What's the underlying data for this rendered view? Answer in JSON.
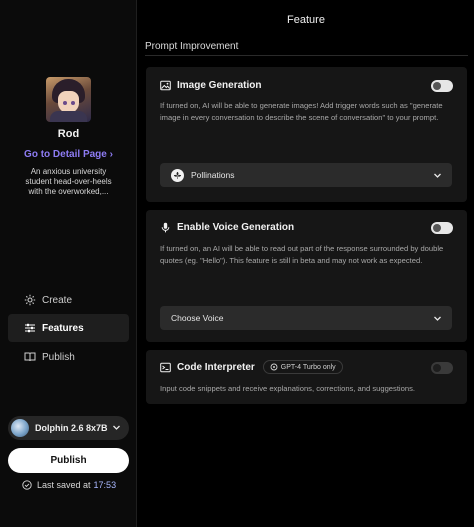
{
  "sidebar": {
    "character_name": "Rod",
    "detail_link": "Go to Detail Page ›",
    "bio": "An anxious university student head-over-heels with the overworked,...",
    "nav": [
      {
        "label": "Create",
        "icon": "gear-icon"
      },
      {
        "label": "Features",
        "icon": "sliders-icon"
      },
      {
        "label": "Publish",
        "icon": "book-icon"
      }
    ],
    "model": "Dolphin 2.6 8x7B",
    "publish_button": "Publish",
    "saved_label": "Last saved at",
    "saved_time": "17:53"
  },
  "main": {
    "title": "Feature",
    "section": "Prompt Improvement",
    "cards": {
      "image": {
        "title": "Image Generation",
        "description": "If turned on, AI will be able to generate images! Add trigger words such as \"generate image in every conversation to describe the scene of conversation\" to your prompt.",
        "dropdown": "Pollinations",
        "enabled": false
      },
      "voice": {
        "title": "Enable Voice Generation",
        "description": "If turned on, an AI will be able to read out part of the response surrounded by double quotes (eg. \"Hello\"). This feature is still in beta and may not work as expected.",
        "dropdown": "Choose Voice",
        "enabled": false
      },
      "code": {
        "title": "Code Interpreter",
        "badge": "GPT-4 Turbo only",
        "description": "Input code snippets and receive explanations, corrections, and suggestions.",
        "enabled": false
      }
    }
  },
  "colors": {
    "accent": "#8e7cf4",
    "time": "#a9b8ff",
    "card_bg": "#161616",
    "page_bg": "#000000"
  }
}
